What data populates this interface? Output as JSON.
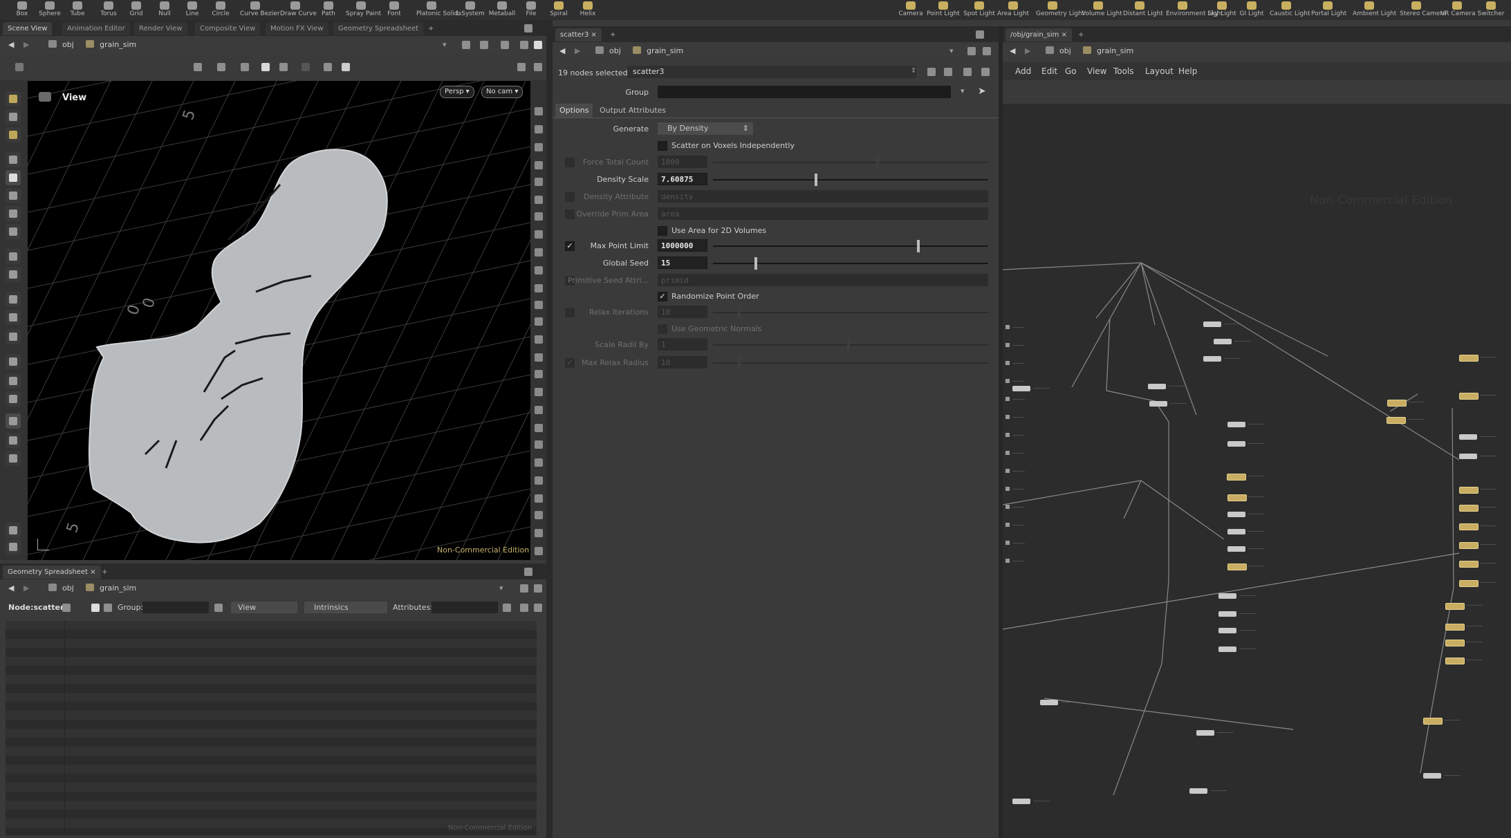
{
  "shelf": {
    "tools_left": [
      "Box",
      "Sphere",
      "Tube",
      "Torus",
      "Grid",
      "Null",
      "Line",
      "Circle",
      "Curve Bezier",
      "Draw Curve",
      "Path",
      "Spray Paint",
      "Font",
      "Platonic Solids",
      "L-System",
      "Metaball",
      "File",
      "Spiral",
      "Helix"
    ],
    "tools_right": [
      "Camera",
      "Point Light",
      "Spot Light",
      "Area Light",
      "Geometry Light",
      "Volume Light",
      "Distant Light",
      "Environment Light",
      "Sky Light",
      "GI Light",
      "Caustic Light",
      "Portal Light",
      "Ambient Light",
      "Stereo Camera",
      "VR Camera",
      "Switcher"
    ]
  },
  "left_pane": {
    "tabs": [
      "Scene View",
      "Animation Editor",
      "Render View",
      "Composite View",
      "Motion FX View",
      "Geometry Spreadsheet"
    ],
    "path_root": "obj",
    "path_node": "grain_sim",
    "viewport_title": "View",
    "persp_label": "Persp",
    "cam_label": "No cam",
    "watermark": "Non-Commercial Edition",
    "grid_labels": [
      "5",
      "0",
      "0",
      "5"
    ]
  },
  "spreadsheet": {
    "tab": "Geometry Spreadsheet",
    "path_root": "obj",
    "path_node": "grain_sim",
    "node_label": "Node:",
    "node_value": "scatter3",
    "group_label": "Group:",
    "view_label": "View",
    "intrinsics_label": "Intrinsics",
    "attributes_label": "Attributes:",
    "watermark": "Non-Commercial Edition"
  },
  "params": {
    "tab": "scatter3",
    "path_root": "obj",
    "path_node": "grain_sim",
    "selected_label": "19 nodes selected:",
    "selected_value": "scatter3",
    "group_label": "Group",
    "subtabs": [
      "Options",
      "Output Attributes"
    ],
    "generate_label": "Generate",
    "generate_value": "By Density",
    "scatter_voxels": "Scatter on Voxels Independently",
    "force_total_label": "Force Total Count",
    "force_total_value": "1000",
    "density_scale_label": "Density Scale",
    "density_scale_value": "7.60875",
    "density_attr_label": "Density Attribute",
    "density_attr_value": "density",
    "override_prim_label": "Override Prim Area",
    "override_prim_value": "area",
    "use_area_2d": "Use Area for 2D Volumes",
    "max_point_label": "Max Point Limit",
    "max_point_value": "1000000",
    "global_seed_label": "Global Seed",
    "global_seed_value": "15",
    "prim_seed_label": "Primitive Seed Attri...",
    "prim_seed_value": "primid",
    "randomize": "Randomize Point Order",
    "relax_label": "Relax Iterations",
    "relax_value": "10",
    "use_geo_normals": "Use Geometric Normals",
    "scale_radii_label": "Scale Radii By",
    "scale_radii_value": "1",
    "max_relax_label": "Max Relax Radius",
    "max_relax_value": "10",
    "density_scale_pos": 0.37,
    "max_point_pos": 0.74,
    "global_seed_pos": 0.15
  },
  "network": {
    "tab": "/obj/grain_sim",
    "path_root": "obj",
    "path_node": "grain_sim",
    "menu": [
      "Add",
      "Edit",
      "Go",
      "View",
      "Tools",
      "Layout",
      "Help"
    ],
    "watermark": "Non-Commercial Edition"
  }
}
